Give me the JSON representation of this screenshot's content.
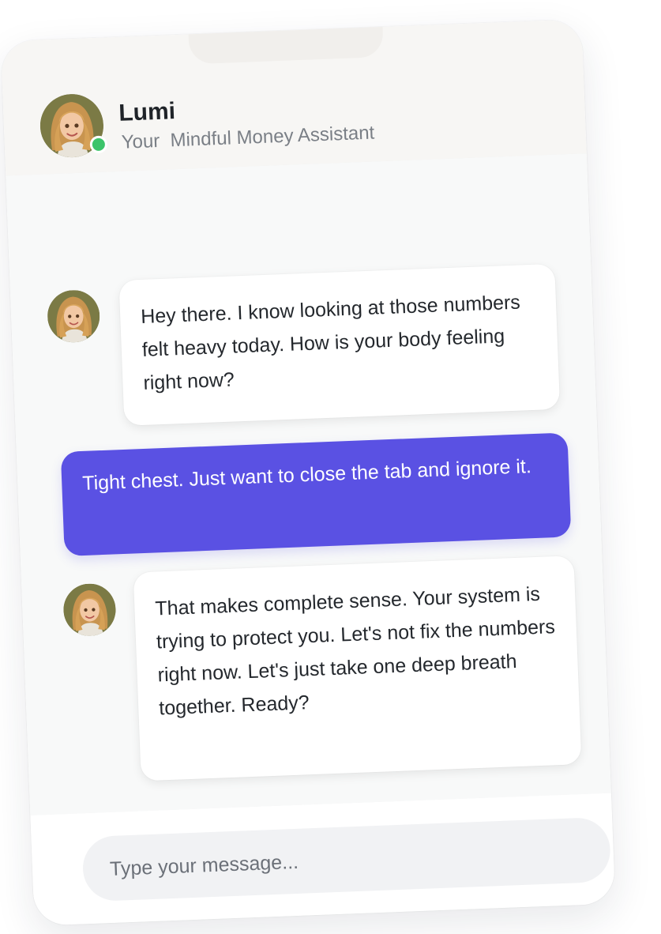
{
  "assistant": {
    "name": "Lumi",
    "subtitle": "Your  Mindful Money Assistant",
    "status": "online",
    "avatar_icon": "assistant-avatar"
  },
  "messages": [
    {
      "sender": "assistant",
      "text": "Hey there. I know looking at those numbers felt heavy today. How is your body feeling right now?"
    },
    {
      "sender": "user",
      "text": "Tight chest. Just want to close the tab and ignore it."
    },
    {
      "sender": "assistant",
      "text": "That makes complete sense. Your system is trying to protect you. Let's not fix the numbers right now. Let's just take one deep breath together. Ready?"
    }
  ],
  "composer": {
    "placeholder": "Type your message..."
  },
  "colors": {
    "user_bubble": "#5a51e3",
    "online_dot": "#3cc46a",
    "header_bg": "#f7f6f4"
  }
}
